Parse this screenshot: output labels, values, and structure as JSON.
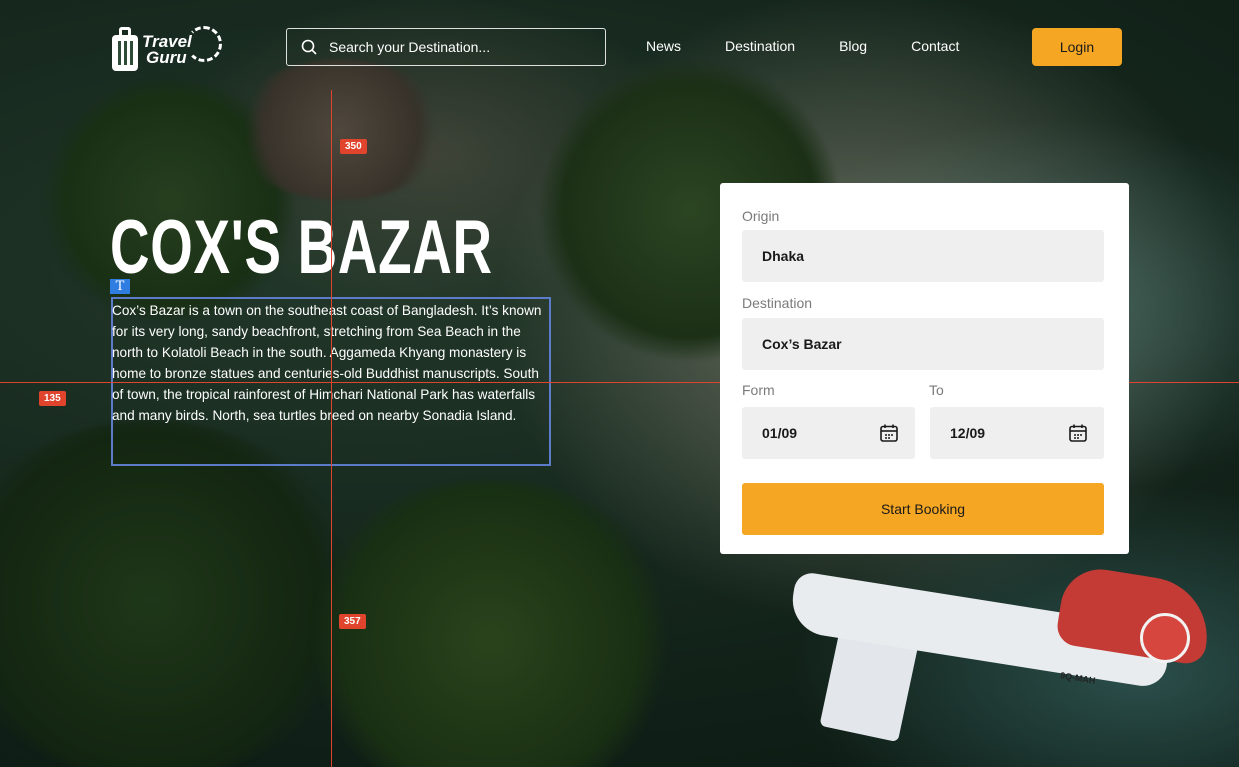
{
  "header": {
    "logo_line1": "Travel",
    "logo_line2": "Guru",
    "search_placeholder": "Search your Destination...",
    "nav": [
      "News",
      "Destination",
      "Blog",
      "Contact"
    ],
    "login_label": "Login"
  },
  "hero": {
    "title": "COX'S BAZAR",
    "description": "Cox’s Bazar is a town on the southeast coast of Bangladesh. It’s known for its very long, sandy beachfront, stretching from Sea Beach in the north to Kolatoli Beach in the south. Aggameda Khyang monastery is home to bronze statues and centuries-old Buddhist manuscripts. South of town, the tropical rainforest of Himchari National Park has waterfalls and many birds. North, sea turtles breed on nearby Sonadia Island.",
    "text_marker": "T"
  },
  "guides": {
    "top": "350",
    "left": "135",
    "right": "800",
    "bottom": "357"
  },
  "booking": {
    "origin_label": "Origin",
    "origin_value": "Dhaka",
    "destination_label": "Destination",
    "destination_value": "Cox’s Bazar",
    "from_label": "Form",
    "from_value": "01/09",
    "to_label": "To",
    "to_value": "12/09",
    "submit_label": "Start Booking"
  },
  "plane_registration": "9Q-MAH",
  "plane_logo": "imo",
  "colors": {
    "accent": "#f5a623",
    "guide": "#e0442c",
    "selection": "#5c7bc9"
  }
}
